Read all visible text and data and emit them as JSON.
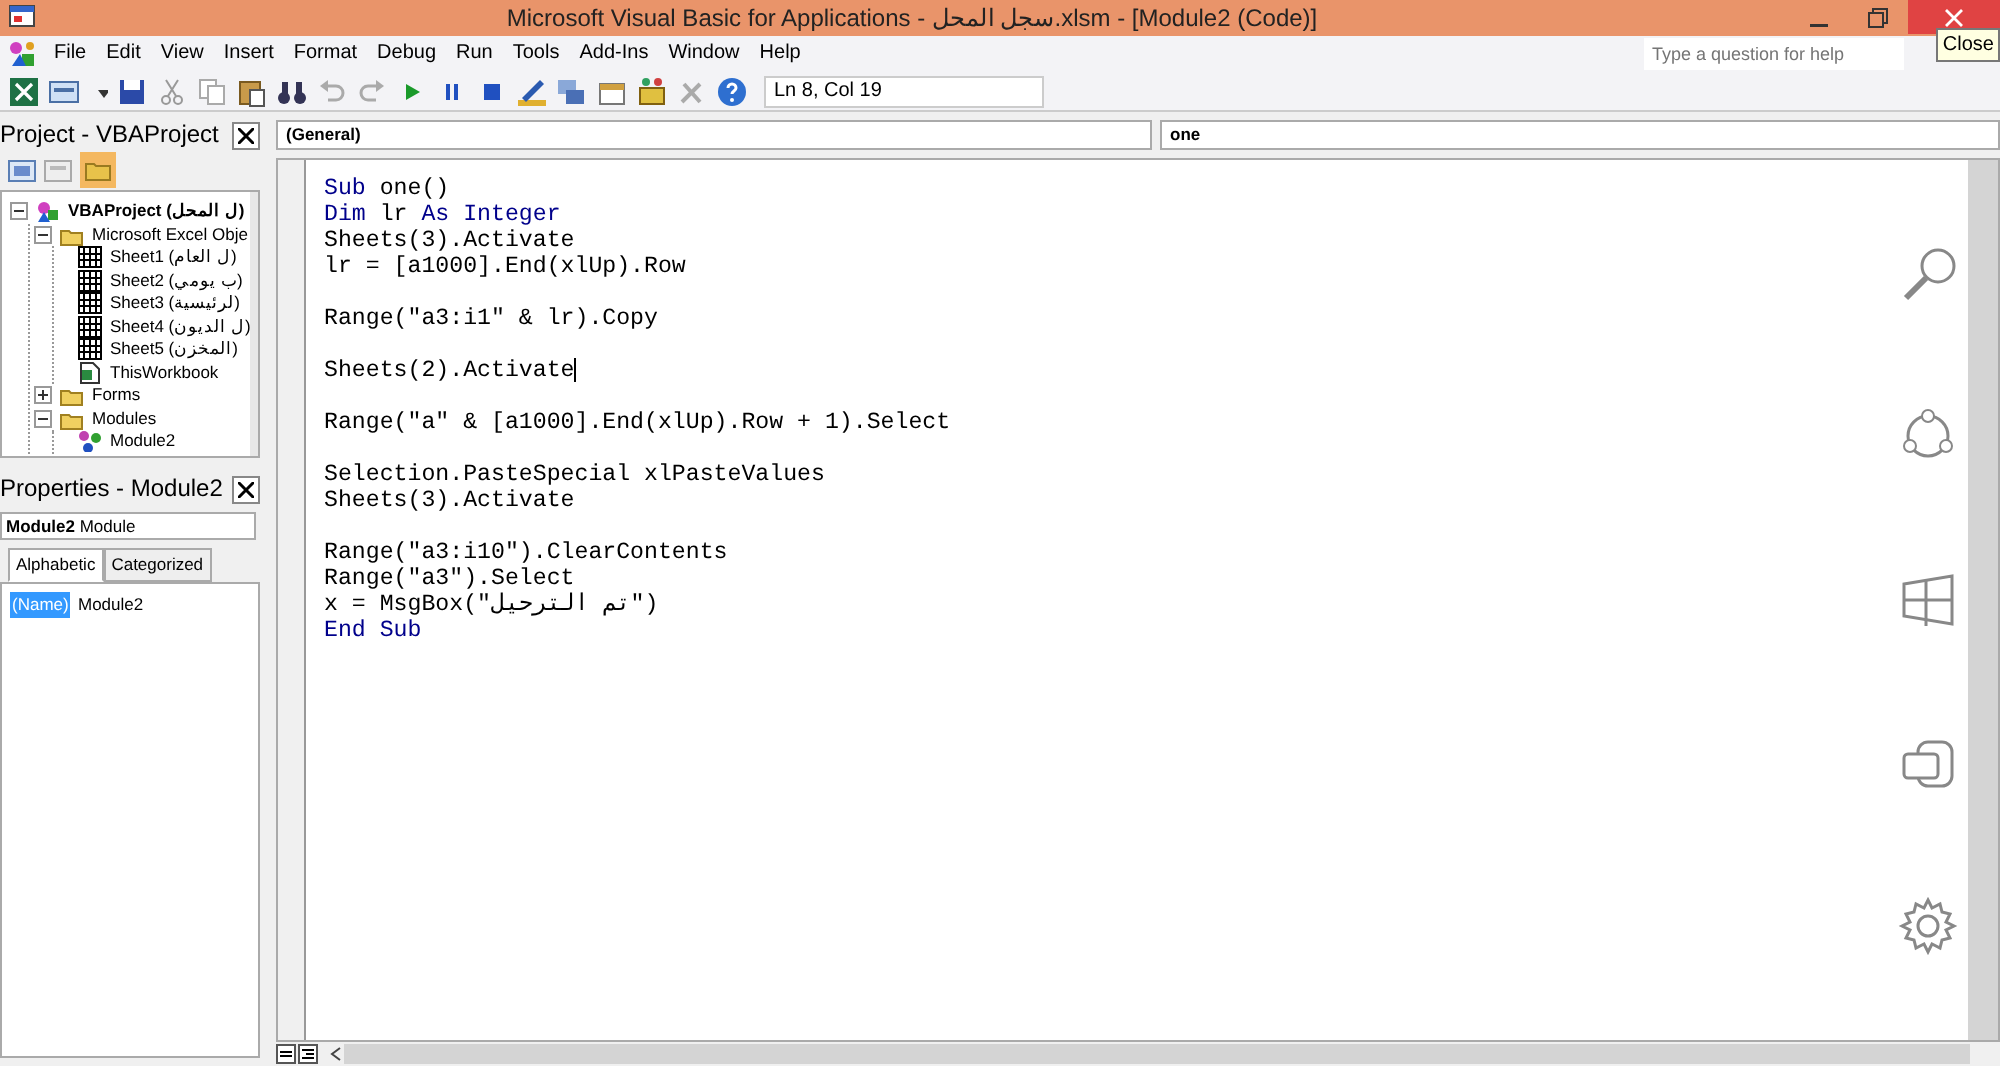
{
  "window": {
    "title": "Microsoft Visual Basic for Applications - سجل المحل.xlsm - [Module2 (Code)]",
    "tooltip": "Close"
  },
  "menu": [
    "File",
    "Edit",
    "View",
    "Insert",
    "Format",
    "Debug",
    "Run",
    "Tools",
    "Add-Ins",
    "Window",
    "Help"
  ],
  "toolbar": {
    "position": "Ln 8, Col 19"
  },
  "help_search": {
    "placeholder": "Type a question for help"
  },
  "project_panel": {
    "title": "Project - VBAProject",
    "tree": [
      {
        "label": "VBAProject (ل المحل)",
        "kind": "project",
        "expanded": true,
        "children": [
          {
            "label": "Microsoft Excel Obje",
            "kind": "folder",
            "expanded": true,
            "children": [
              {
                "label": "Sheet1 (ل العام)",
                "kind": "sheet"
              },
              {
                "label": "Sheet2 (ب يومي)",
                "kind": "sheet"
              },
              {
                "label": "Sheet3 (لرئيسية)",
                "kind": "sheet"
              },
              {
                "label": "Sheet4 (ل الديون)",
                "kind": "sheet"
              },
              {
                "label": "Sheet5 (المخزن)",
                "kind": "sheet"
              },
              {
                "label": "ThisWorkbook",
                "kind": "workbook"
              }
            ]
          },
          {
            "label": "Forms",
            "kind": "folder",
            "expanded": false
          },
          {
            "label": "Modules",
            "kind": "folder",
            "expanded": true,
            "children": [
              {
                "label": "Module2",
                "kind": "module"
              }
            ]
          }
        ]
      }
    ]
  },
  "properties_panel": {
    "title": "Properties - Module2",
    "object": "**Module2** Module",
    "tabs": [
      {
        "label": "Alphabetic",
        "selected": true
      },
      {
        "label": "Categorized",
        "selected": false
      }
    ],
    "rows": [
      {
        "name": "(Name)",
        "value": "Module2",
        "selected": true
      }
    ]
  },
  "code_window": {
    "object": "(General)",
    "procedure": "one",
    "lines": [
      {
        "kind": "code",
        "segments": [
          {
            "text": "Sub",
            "kind": "keyword"
          },
          {
            "text": " one()",
            "kind": "text"
          }
        ]
      },
      {
        "kind": "code",
        "segments": [
          {
            "text": "Dim",
            "kind": "keyword"
          },
          {
            "text": " lr ",
            "kind": "text"
          },
          {
            "text": "As",
            "kind": "keyword"
          },
          {
            "text": " Integer",
            "kind": "keyword"
          }
        ]
      },
      {
        "kind": "code",
        "segments": [
          {
            "text": "Sheets(3).Activate",
            "kind": "text"
          }
        ]
      },
      {
        "kind": "code",
        "segments": [
          {
            "text": "lr = [a1000].End(xlUp).Row",
            "kind": "text"
          }
        ]
      },
      {
        "kind": "blank"
      },
      {
        "kind": "code",
        "segments": [
          {
            "text": "Range(\"a3:i1\" & lr).Copy",
            "kind": "text"
          }
        ]
      },
      {
        "kind": "blank"
      },
      {
        "kind": "code",
        "caret": true,
        "segments": [
          {
            "text": "Sheets(2).Activate",
            "kind": "text"
          }
        ]
      },
      {
        "kind": "blank"
      },
      {
        "kind": "code",
        "segments": [
          {
            "text": "Range(\"a\" & [a1000].End(xlUp).Row + 1).Select",
            "kind": "text"
          }
        ]
      },
      {
        "kind": "blank"
      },
      {
        "kind": "code",
        "segments": [
          {
            "text": "Selection.PasteSpecial xlPasteValues",
            "kind": "text"
          }
        ]
      },
      {
        "kind": "code",
        "segments": [
          {
            "text": "Sheets(3).Activate",
            "kind": "text"
          }
        ]
      },
      {
        "kind": "blank"
      },
      {
        "kind": "code",
        "segments": [
          {
            "text": "Range(\"a3:i10\").ClearContents",
            "kind": "text"
          }
        ]
      },
      {
        "kind": "code",
        "segments": [
          {
            "text": "Range(\"a3\").Select",
            "kind": "text"
          }
        ]
      },
      {
        "kind": "code",
        "segments": [
          {
            "text": "x = MsgBox(\"تم الترحيل\")",
            "kind": "text"
          }
        ]
      },
      {
        "kind": "code",
        "segments": [
          {
            "text": "End Sub",
            "kind": "keyword"
          }
        ]
      }
    ]
  }
}
